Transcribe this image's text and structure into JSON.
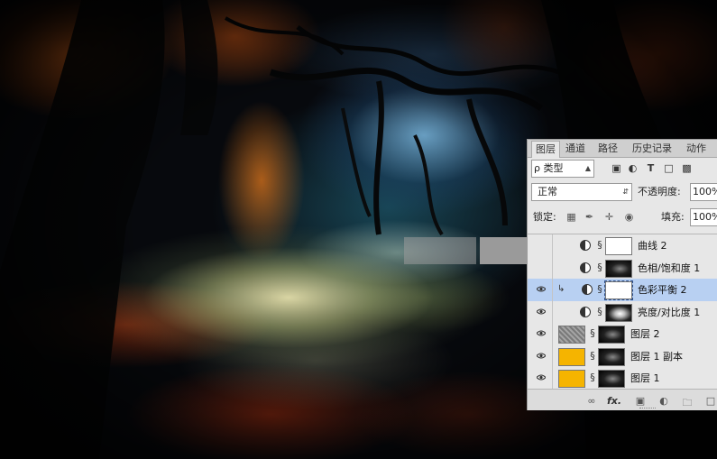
{
  "tabs": [
    "图层",
    "通道",
    "路径",
    "历史记录",
    "动作"
  ],
  "filter": {
    "label": "ρ 类型",
    "icons": [
      "image-filter-icon",
      "adjustment-filter-icon",
      "type-filter-icon",
      "shape-filter-icon",
      "smart-object-filter-icon"
    ]
  },
  "blend_mode": "正常",
  "opacity": {
    "label": "不透明度:",
    "value": "100%"
  },
  "lock": {
    "label": "锁定:",
    "icons": [
      "lock-transparent-icon",
      "lock-paint-icon",
      "lock-move-icon",
      "lock-all-icon"
    ]
  },
  "fill": {
    "label": "填充:",
    "value": "100%"
  },
  "layers": [
    {
      "name": "曲线 2",
      "visible": false,
      "adjustment": true,
      "clipped": false,
      "selected": false,
      "mask": "white"
    },
    {
      "name": "色相/饱和度 1",
      "visible": false,
      "adjustment": true,
      "clipped": false,
      "selected": false,
      "mask": "dark"
    },
    {
      "name": "色彩平衡 2",
      "visible": true,
      "adjustment": true,
      "clipped": true,
      "selected": true,
      "mask": "white"
    },
    {
      "name": "亮度/对比度 1",
      "visible": true,
      "adjustment": true,
      "clipped": false,
      "selected": false,
      "mask": "dark-glow"
    },
    {
      "name": "图层 2",
      "visible": true,
      "adjustment": false,
      "clipped": false,
      "selected": false,
      "thumb": "#8e8e8e",
      "mask": "dark"
    },
    {
      "name": "图层 1 副本",
      "visible": true,
      "adjustment": false,
      "clipped": false,
      "selected": false,
      "thumb": "#f5b400",
      "mask": "dark"
    },
    {
      "name": "图层 1",
      "visible": true,
      "adjustment": false,
      "clipped": false,
      "selected": false,
      "thumb": "#f5b400",
      "mask": "dark"
    }
  ],
  "bottom_icons": [
    "link-layers-icon",
    "fx-icon",
    "add-mask-icon",
    "new-adjustment-icon",
    "new-group-icon",
    "new-layer-icon"
  ],
  "bottom_fx_label": "fx."
}
